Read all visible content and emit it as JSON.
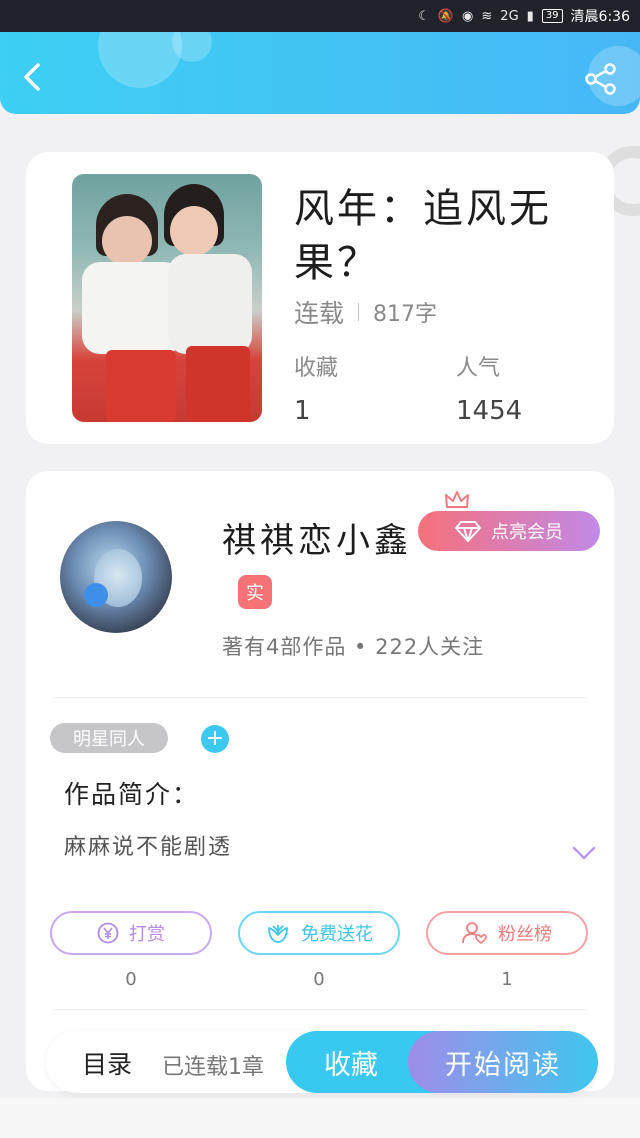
{
  "status_bar": {
    "time": "清晨6:36",
    "battery": "39",
    "network": "2G"
  },
  "book": {
    "title": "风年：追风无果？",
    "status": "连载",
    "word_count": "817字",
    "favorites_label": "收藏",
    "favorites_value": "1",
    "popularity_label": "人气",
    "popularity_value": "1454"
  },
  "author": {
    "name": "祺祺恋小鑫",
    "vip_button": "点亮会员",
    "verified_badge": "实",
    "meta": "著有4部作品 • 222人关注"
  },
  "tags": [
    "明星同人"
  ],
  "intro": {
    "title": "作品简介：",
    "text": "麻麻说不能剧透"
  },
  "actions": [
    {
      "label": "打赏",
      "count": "0",
      "color": "#b48be6"
    },
    {
      "label": "免费送花",
      "count": "0",
      "color": "#3cc6ee"
    },
    {
      "label": "粉丝榜",
      "count": "1",
      "color": "#f27b7d"
    }
  ],
  "bottom_bar": {
    "toc_label": "目录",
    "toc_count": "已连载1章",
    "favorite_button": "收藏",
    "read_button": "开始阅读"
  },
  "colors": {
    "accent_blue": "#3ecff4",
    "vip_pink": "#f6707b",
    "vip_purple": "#c18ae8"
  }
}
